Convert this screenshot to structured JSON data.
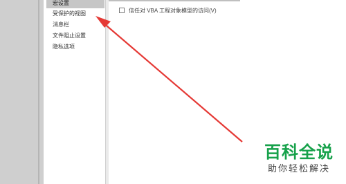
{
  "nav": {
    "items": [
      {
        "label": "宏设置",
        "selected": true
      },
      {
        "label": "受保护的视图",
        "selected": false
      },
      {
        "label": "消息栏",
        "selected": false
      },
      {
        "label": "文件阻止设置",
        "selected": false
      },
      {
        "label": "隐私选项",
        "selected": false
      }
    ]
  },
  "content": {
    "trust_vba_label": "信任对 VBA 工程对象模型的访问(V)",
    "trust_vba_checked": false
  },
  "annotation": {
    "arrow_color": "#e53935"
  },
  "watermark": {
    "title": "百科全说",
    "subtitle": "助你轻松解决",
    "title_color": "#16a14a"
  }
}
